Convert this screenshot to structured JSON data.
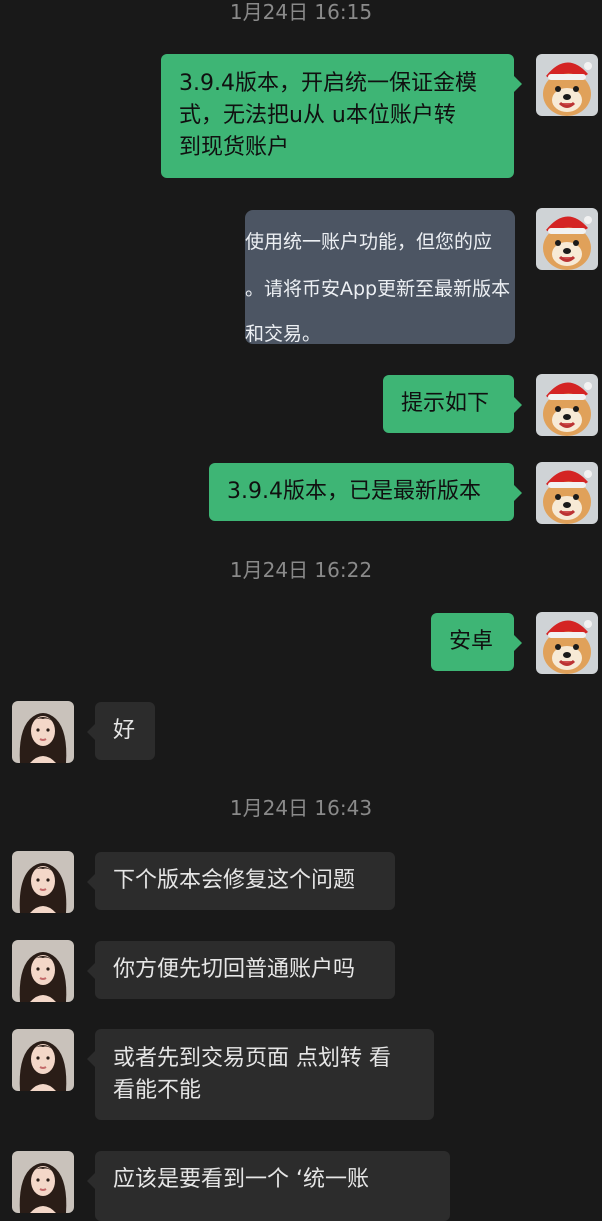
{
  "timestamps": [
    "1月24日 16:15",
    "1月24日 16:22",
    "1月24日 16:43"
  ],
  "messages": {
    "m1": [
      "3.9.4版本，开启统一保证金模",
      "式，无法把u从 u本位账户转",
      "到现货账户"
    ],
    "m2_image_lines": [
      "使用统一账户功能，但您的应",
      "。请将币安App更新至最新版本",
      "和交易。"
    ],
    "m3": "提示如下",
    "m4": "3.9.4版本，已是最新版本",
    "m5": "安卓",
    "m6": "好",
    "m7": "下个版本会修复这个问题",
    "m8": "你方便先切回普通账户吗",
    "m9": [
      "或者先到交易页面 点划转 看",
      "看能不能"
    ],
    "m10": "应该是要看到一个 ‘统一账"
  },
  "avatars": {
    "me": "shiba-dog-santa-hat-icon",
    "other": "woman-portrait-icon"
  },
  "colors": {
    "background": "#191919",
    "my_bubble": "#3eb575",
    "other_bubble": "#2c2c2c",
    "image_message": "#4c5563",
    "timestamp_text": "#8a8a8a"
  }
}
